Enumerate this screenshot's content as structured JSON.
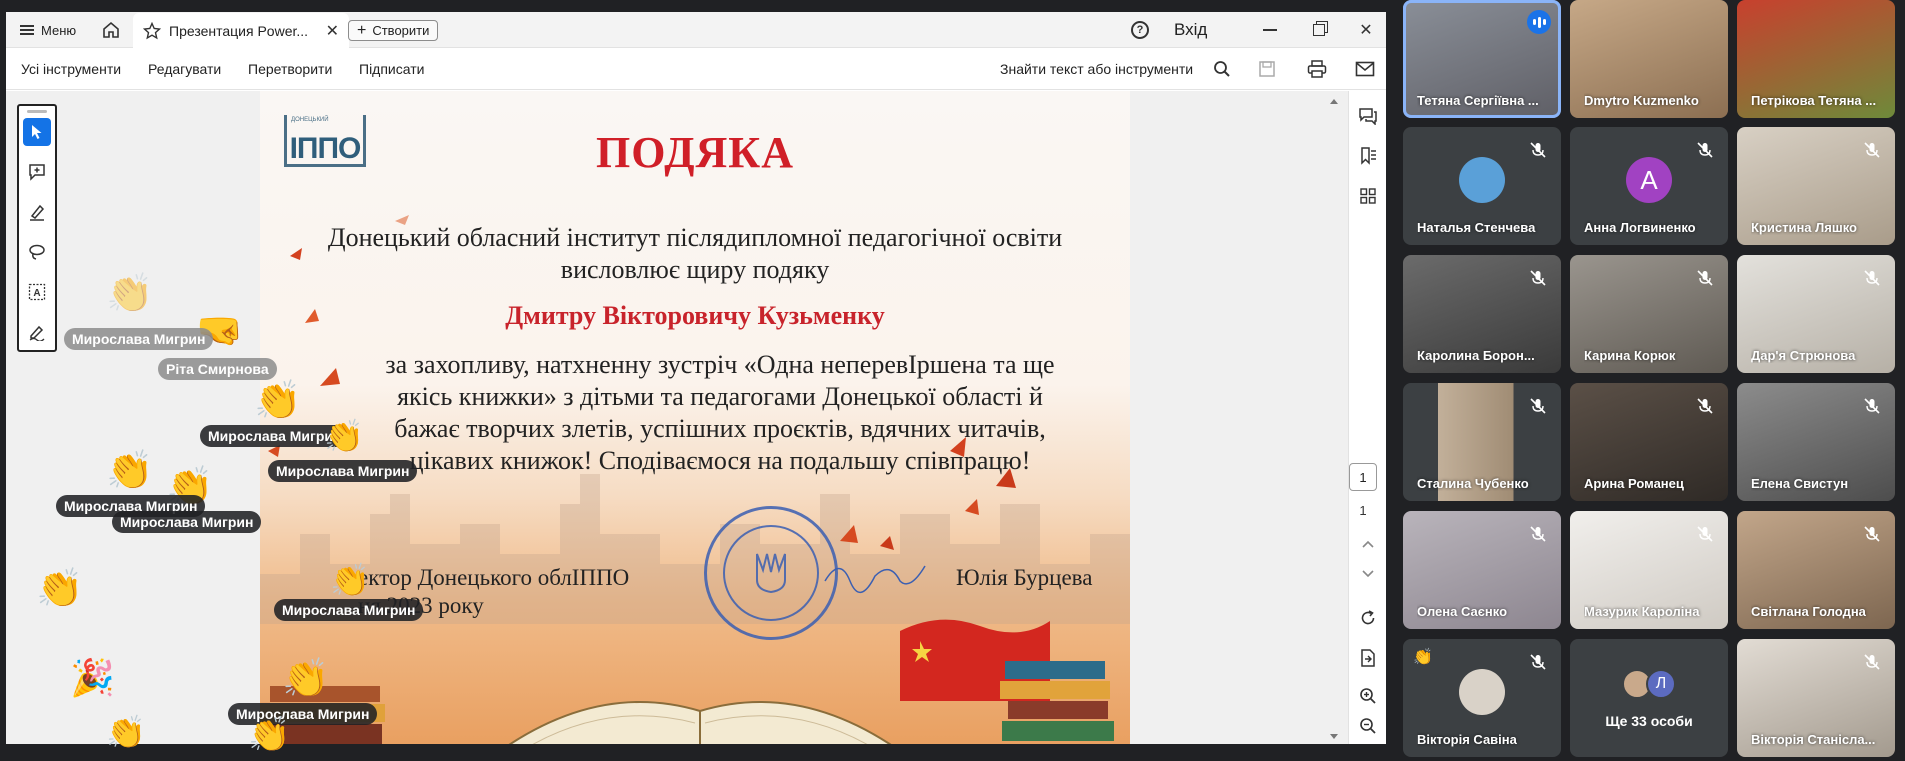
{
  "acrobat": {
    "menu_label": "Меню",
    "tab_title": "Презентация Power...",
    "create_label": "Створити",
    "signin_label": "Вхід",
    "toolbar": {
      "all_tools": "Усі інструменти",
      "edit": "Редагувати",
      "convert": "Перетворити",
      "sign": "Підписати",
      "find": "Знайти текст або інструменти"
    },
    "page_nav": {
      "current": "1",
      "total": "1"
    }
  },
  "certificate": {
    "logo_text": "ІППО",
    "logo_small": "ДОНЕЦЬКИЙ",
    "title": "ПОДЯКА",
    "line1": "Донецький обласний інститут післядипломної педагогічної освіти",
    "line2": "висловлює щиру подяку",
    "recipient": "Дмитру Вікторовичу Кузьменку",
    "body1": "за захопливу, натхненну зустріч «Одна неперевІршена та ще",
    "body2": "якісь книжки» з дітьми та педагогами Донецької області й",
    "body3": "бажає творчих злетів, успішних проєктів, вдячних читачів,",
    "body4": "цікавих книжок! Сподіваємося на подальшу співпрацю!",
    "sig_left1": "ектор Донецького облІППО",
    "sig_left2": "ня 2023 року",
    "sig_right": "Юлія Бурцева"
  },
  "reactions": {
    "pills": [
      "Мирослава Мигрин",
      "Ріта Смирнова",
      "Мирослава Мигрин",
      "Мирослава Мигрин",
      "Мирослава Мигрин",
      "Мирослава Мигрин",
      "Мирослава Мигрин",
      "Мирослава Мигрин"
    ]
  },
  "participants": [
    {
      "name": "Тетяна Сергіївна ..."
    },
    {
      "name": "Dmytro Kuzmenko"
    },
    {
      "name": "Петрікова Тетяна ..."
    },
    {
      "name": "Наталья Стенчева"
    },
    {
      "name": "Анна Логвиненко",
      "initial": "A"
    },
    {
      "name": "Кристина Ляшко"
    },
    {
      "name": "Каролина Борон..."
    },
    {
      "name": "Карина Корюк"
    },
    {
      "name": "Дар'я Стрюнова"
    },
    {
      "name": "Сталина Чубенко"
    },
    {
      "name": "Арина Романец"
    },
    {
      "name": "Елена Свистун"
    },
    {
      "name": "Олена Саєнко"
    },
    {
      "name": "Мазурик Кароліна"
    },
    {
      "name": "Світлана Голодна"
    },
    {
      "name": "Вікторія Савіна"
    },
    {
      "name": "Ще 33 особи",
      "initial": "Л"
    },
    {
      "name": "Вікторія Станісла..."
    }
  ],
  "colors": {
    "accent": "#1473e6",
    "title_red": "#d01f28",
    "meet_bg": "#202124",
    "tile_bg": "#3c4043",
    "speaking": "#8ab4f8"
  }
}
